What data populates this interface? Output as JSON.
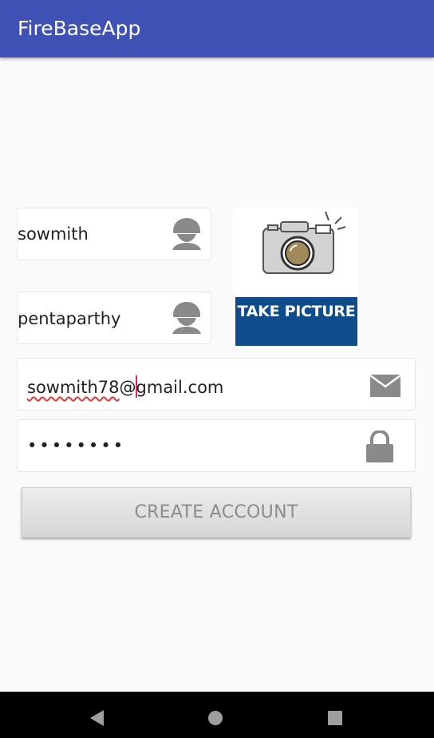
{
  "app_bar": {
    "title": "FireBaseApp",
    "color": "#3f51b5"
  },
  "form": {
    "first_name": {
      "value": "sowmith",
      "icon": "person-icon"
    },
    "last_name": {
      "value": "pentaparthy",
      "icon": "person-icon"
    },
    "email": {
      "value_before_cursor": "sowmith78",
      "value_middle": "@",
      "value_after_cursor": "gmail.com",
      "icon": "mail-icon"
    },
    "password": {
      "masked_value": "••••••••",
      "icon": "lock-icon"
    },
    "photo": {
      "icon": "camera-icon",
      "button_label": "TAKE PICTURE",
      "button_color": "#0e4c8b"
    },
    "create_button_label": "CREATE ACCOUNT"
  },
  "nav_bar": {
    "back": "back-icon",
    "home": "home-icon",
    "recents": "recents-icon"
  }
}
